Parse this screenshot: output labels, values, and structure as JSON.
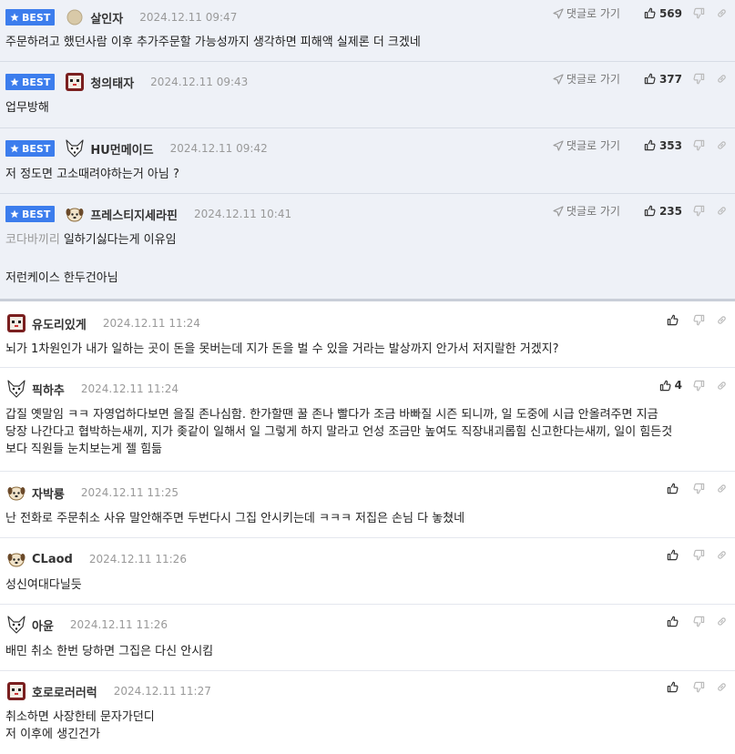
{
  "labels": {
    "best": "BEST",
    "reply": "댓글로 가기"
  },
  "best_comments": [
    {
      "nick": "살인자",
      "date": "2024.12.11 09:47",
      "likes": "569",
      "avatar": "round-avatar",
      "text": "주문하려고 했던사람 이후 추가주문할 가능성까지 생각하면 피해액 실제론 더 크겠네"
    },
    {
      "nick": "청의태자",
      "date": "2024.12.11 09:43",
      "likes": "377",
      "avatar": "pixel-face-avatar",
      "text": "업무방해"
    },
    {
      "nick": "HU먼메이드",
      "date": "2024.12.11 09:42",
      "likes": "353",
      "avatar": "fox-avatar",
      "text": "저 정도면 고소때려야하는거 아님 ?"
    },
    {
      "nick": "프레스티지세라핀",
      "date": "2024.12.11 10:41",
      "likes": "235",
      "avatar": "dog-avatar",
      "mention": "코다바끼리",
      "text": "일하기싫다는게 이유임",
      "text2": "저런케이스 한두건아님"
    }
  ],
  "comments": [
    {
      "nick": "유도리있게",
      "date": "2024.12.11 11:24",
      "likes": "",
      "avatar": "pixel-face-avatar",
      "text": "뇌가 1차원인가 내가 일하는 곳이 돈을 못버는데 지가 돈을 벌 수 있을 거라는 발상까지 안가서 저지랄한 거겠지?"
    },
    {
      "nick": "픽하추",
      "date": "2024.12.11 11:24",
      "likes": "4",
      "avatar": "fox-avatar",
      "text": "갑질 옛말임 ㅋㅋ 자영업하다보면 을질 존나심함. 한가할땐 꿀 존나 빨다가 조금 바빠질 시즌 되니까, 일 도중에 시급 안올려주면 지금",
      "text2": "당장 나간다고 협박하는새끼, 지가 좆같이 일해서 일 그렇게 하지 말라고 언성 조금만 높여도 직장내괴롭힘 신고한다는새끼, 일이 힘든것",
      "text3": "보다 직원들 눈치보는게 젤 힘듦"
    },
    {
      "nick": "자박룡",
      "date": "2024.12.11 11:25",
      "likes": "",
      "avatar": "dog-avatar",
      "text": "난 전화로 주문취소 사유 말안해주면 두번다시 그집 안시키는데 ㅋㅋㅋ 저집은 손님 다 놓쳤네"
    },
    {
      "nick": "CLaod",
      "date": "2024.12.11 11:26",
      "likes": "",
      "avatar": "dog-avatar",
      "text": "성신여대다닐듯"
    },
    {
      "nick": "아윤",
      "date": "2024.12.11 11:26",
      "likes": "",
      "avatar": "fox-avatar",
      "text": "배민 취소 한번 당하면 그집은 다신 안시킴"
    },
    {
      "nick": "호로로러러럭",
      "date": "2024.12.11 11:27",
      "likes": "",
      "avatar": "pixel-face-avatar",
      "text": "취소하면 사장한테 문자가던디",
      "text2": "저 이후에 생긴건가"
    }
  ]
}
